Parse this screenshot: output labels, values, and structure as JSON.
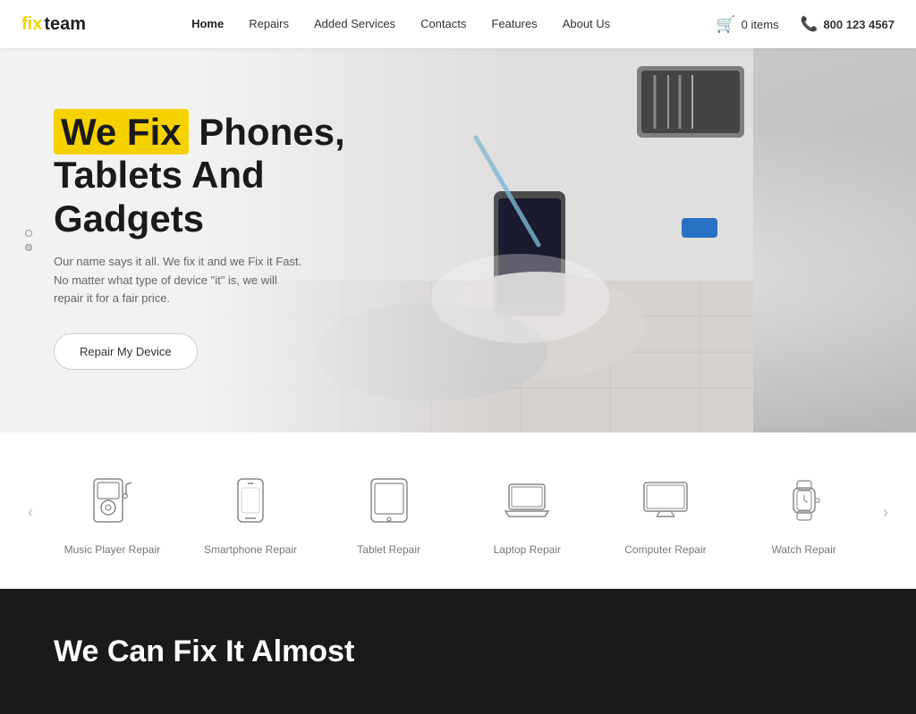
{
  "brand": {
    "name_fix": "fix",
    "name_team": "team"
  },
  "nav": {
    "links": [
      {
        "label": "Home",
        "active": true
      },
      {
        "label": "Repairs",
        "active": false
      },
      {
        "label": "Added Services",
        "active": false
      },
      {
        "label": "Contacts",
        "active": false
      },
      {
        "label": "Features",
        "active": false
      },
      {
        "label": "About Us",
        "active": false
      }
    ],
    "cart_label": "0 items",
    "phone": "800 123 4567"
  },
  "hero": {
    "title_highlight": "We Fix",
    "title_rest": " Phones,\nTablets And\nGadgets",
    "subtitle": "Our name says it all. We fix it and we Fix it Fast. No matter what type of device \"it\" is, we will repair it for a fair price.",
    "cta_label": "Repair My Device"
  },
  "services": {
    "prev_arrow": "‹",
    "next_arrow": "›",
    "items": [
      {
        "label": "Music Player Repair",
        "icon": "music-player"
      },
      {
        "label": "Smartphone Repair",
        "icon": "smartphone"
      },
      {
        "label": "Tablet Repair",
        "icon": "tablet"
      },
      {
        "label": "Laptop Repair",
        "icon": "laptop"
      },
      {
        "label": "Computer Repair",
        "icon": "computer"
      },
      {
        "label": "Watch Repair",
        "icon": "watch"
      }
    ]
  },
  "dark_section": {
    "title": "We Can Fix It Almost"
  },
  "colors": {
    "accent": "#f5d100",
    "dark": "#1a1a1a",
    "text": "#333"
  }
}
